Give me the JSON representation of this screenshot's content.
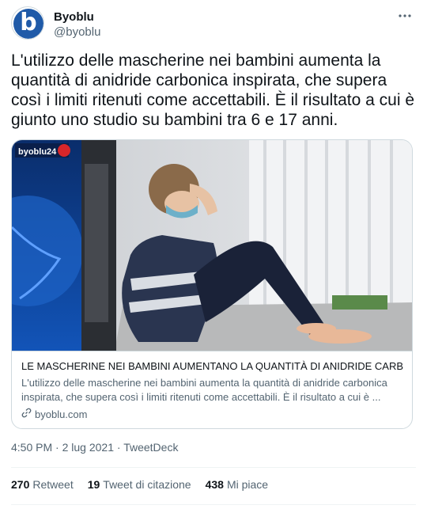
{
  "header": {
    "name": "Byoblu",
    "handle": "@byoblu",
    "avatar_letter": "b",
    "more_icon": "more-horizontal-icon"
  },
  "tweet": {
    "text": "L'utilizzo delle mascherine nei bambini aumenta la quantità di anidride carbonica inspirata, che supera così i limiti ritenuti come accettabili. È il risultato a cui è giunto uno studio su bambini tra 6 e 17 anni."
  },
  "card": {
    "image_logo_text": "byoblu24",
    "title": "LE MASCHERINE NEI BAMBINI AUMENTANO LA QUANTITÀ DI ANIDRIDE CARB...",
    "description": "L'utilizzo delle mascherine nei bambini aumenta la quantità di anidride carbonica inspirata, che supera così i limiti ritenuti come accettabili. È il risultato a cui è ...",
    "domain": "byoblu.com",
    "link_icon": "link-icon"
  },
  "meta": {
    "time": "4:50 PM",
    "date": "2 lug 2021",
    "source": "TweetDeck",
    "separator": "·"
  },
  "stats": {
    "retweets_count": "270",
    "retweets_label": "Retweet",
    "quotes_count": "19",
    "quotes_label": "Tweet di citazione",
    "likes_count": "438",
    "likes_label": "Mi piace"
  },
  "colors": {
    "brand_blue": "#1f5aa8",
    "text_primary": "#0f1419",
    "text_secondary": "#536471",
    "border": "#cfd9de"
  }
}
